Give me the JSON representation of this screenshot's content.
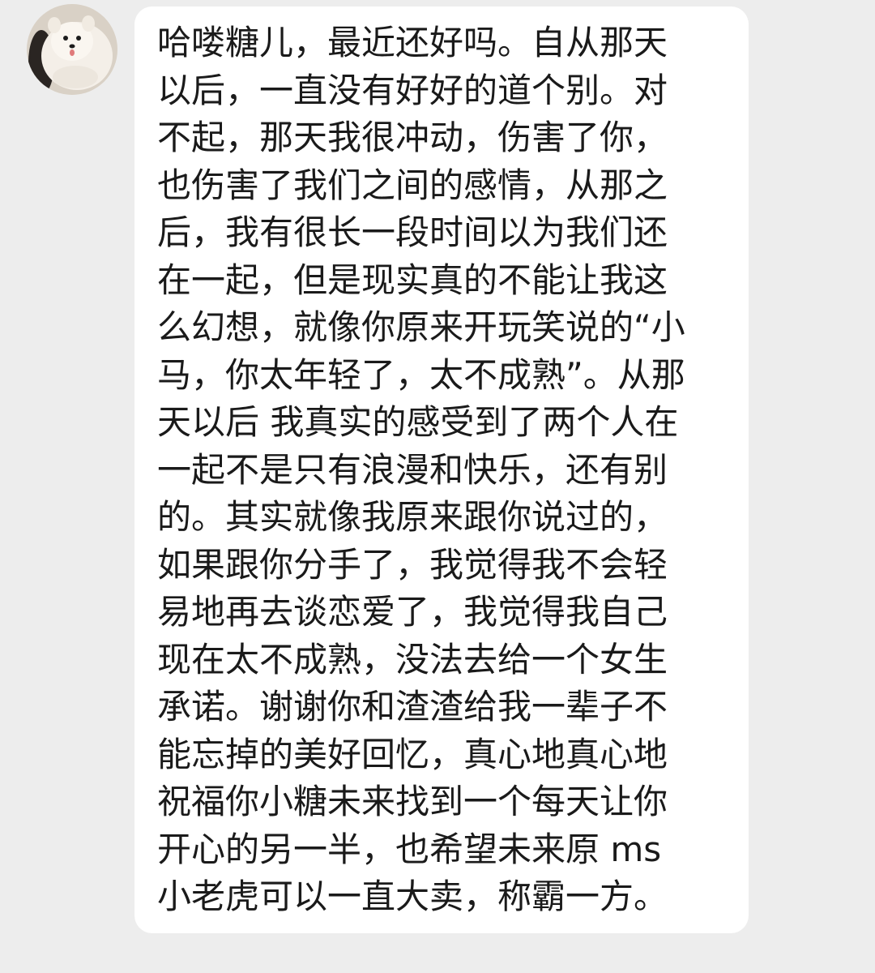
{
  "chat": {
    "sender_avatar": "pomeranian-dog-avatar",
    "message_lines": [
      "哈喽糖儿，最近还好吗。自从那天",
      "以后，一直没有好好的道个别。对",
      "不起，那天我很冲动，伤害了你，",
      "也伤害了我们之间的感情，从那之",
      "后，我有很长一段时间以为我们还",
      "在一起，但是现实真的不能让我这",
      "么幻想，就像你原来开玩笑说的“小",
      "马，你太年轻了，太不成熟”。从那",
      "天以后 我真实的感受到了两个人在",
      "一起不是只有浪漫和快乐，还有别",
      "的。其实就像我原来跟你说过的，",
      "如果跟你分手了，我觉得我不会轻",
      "易地再去谈恋爱了，我觉得我自己",
      "现在太不成熟，没法去给一个女生",
      "承诺。谢谢你和渣渣给我一辈子不",
      "能忘掉的美好回忆，真心地真心地",
      "祝福你小糖未来找到一个每天让你",
      "开心的另一半，也希望未来原 ms",
      "小老虎可以一直大卖，称霸一方。"
    ]
  },
  "colors": {
    "background": "#ededed",
    "bubble": "#ffffff",
    "text": "#1a1a1a"
  }
}
